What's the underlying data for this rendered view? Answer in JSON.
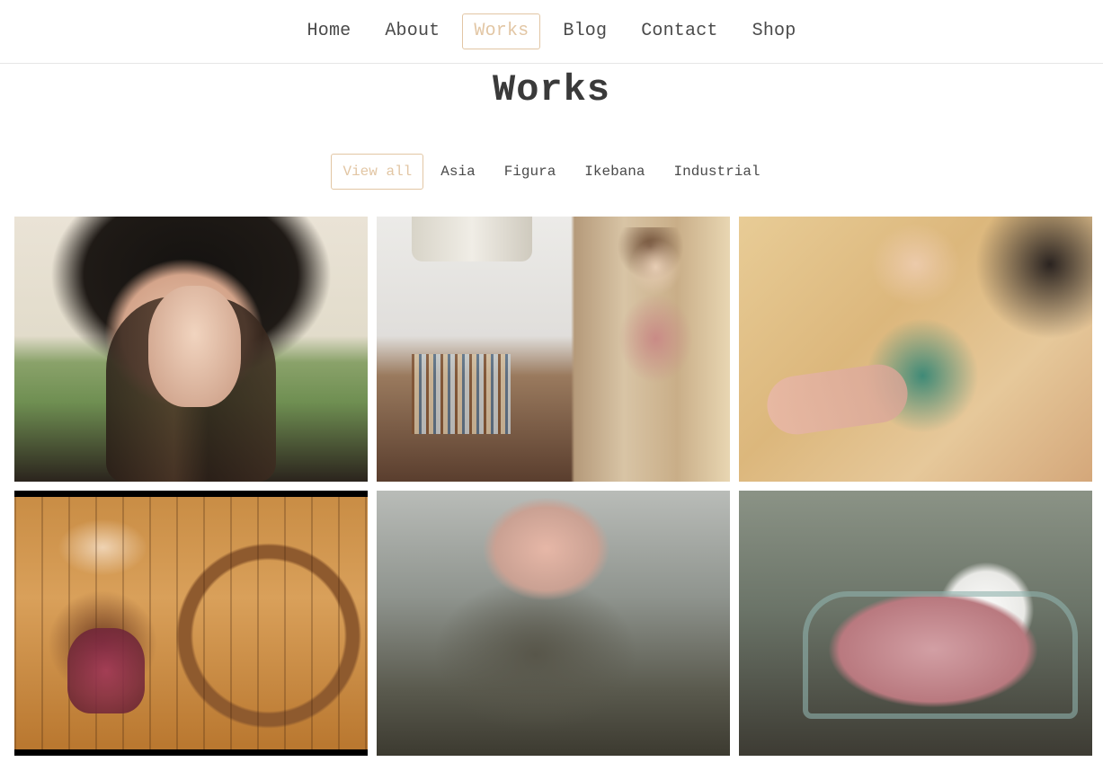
{
  "nav": {
    "items": [
      {
        "label": "Home",
        "active": false
      },
      {
        "label": "About",
        "active": false
      },
      {
        "label": "Works",
        "active": true
      },
      {
        "label": "Blog",
        "active": false
      },
      {
        "label": "Contact",
        "active": false
      },
      {
        "label": "Shop",
        "active": false
      }
    ]
  },
  "page": {
    "title": "Works"
  },
  "filters": [
    {
      "label": "View all",
      "active": true
    },
    {
      "label": "Asia",
      "active": false
    },
    {
      "label": "Figura",
      "active": false
    },
    {
      "label": "Ikebana",
      "active": false
    },
    {
      "label": "Industrial",
      "active": false
    }
  ],
  "gallery": {
    "tiles": [
      {
        "id": "t1"
      },
      {
        "id": "t2"
      },
      {
        "id": "t3"
      },
      {
        "id": "t4"
      },
      {
        "id": "t5"
      },
      {
        "id": "t6"
      }
    ]
  },
  "colors": {
    "accent": "#e2c6a4",
    "text": "#4a4a4a",
    "divider": "#e6e6e6"
  }
}
